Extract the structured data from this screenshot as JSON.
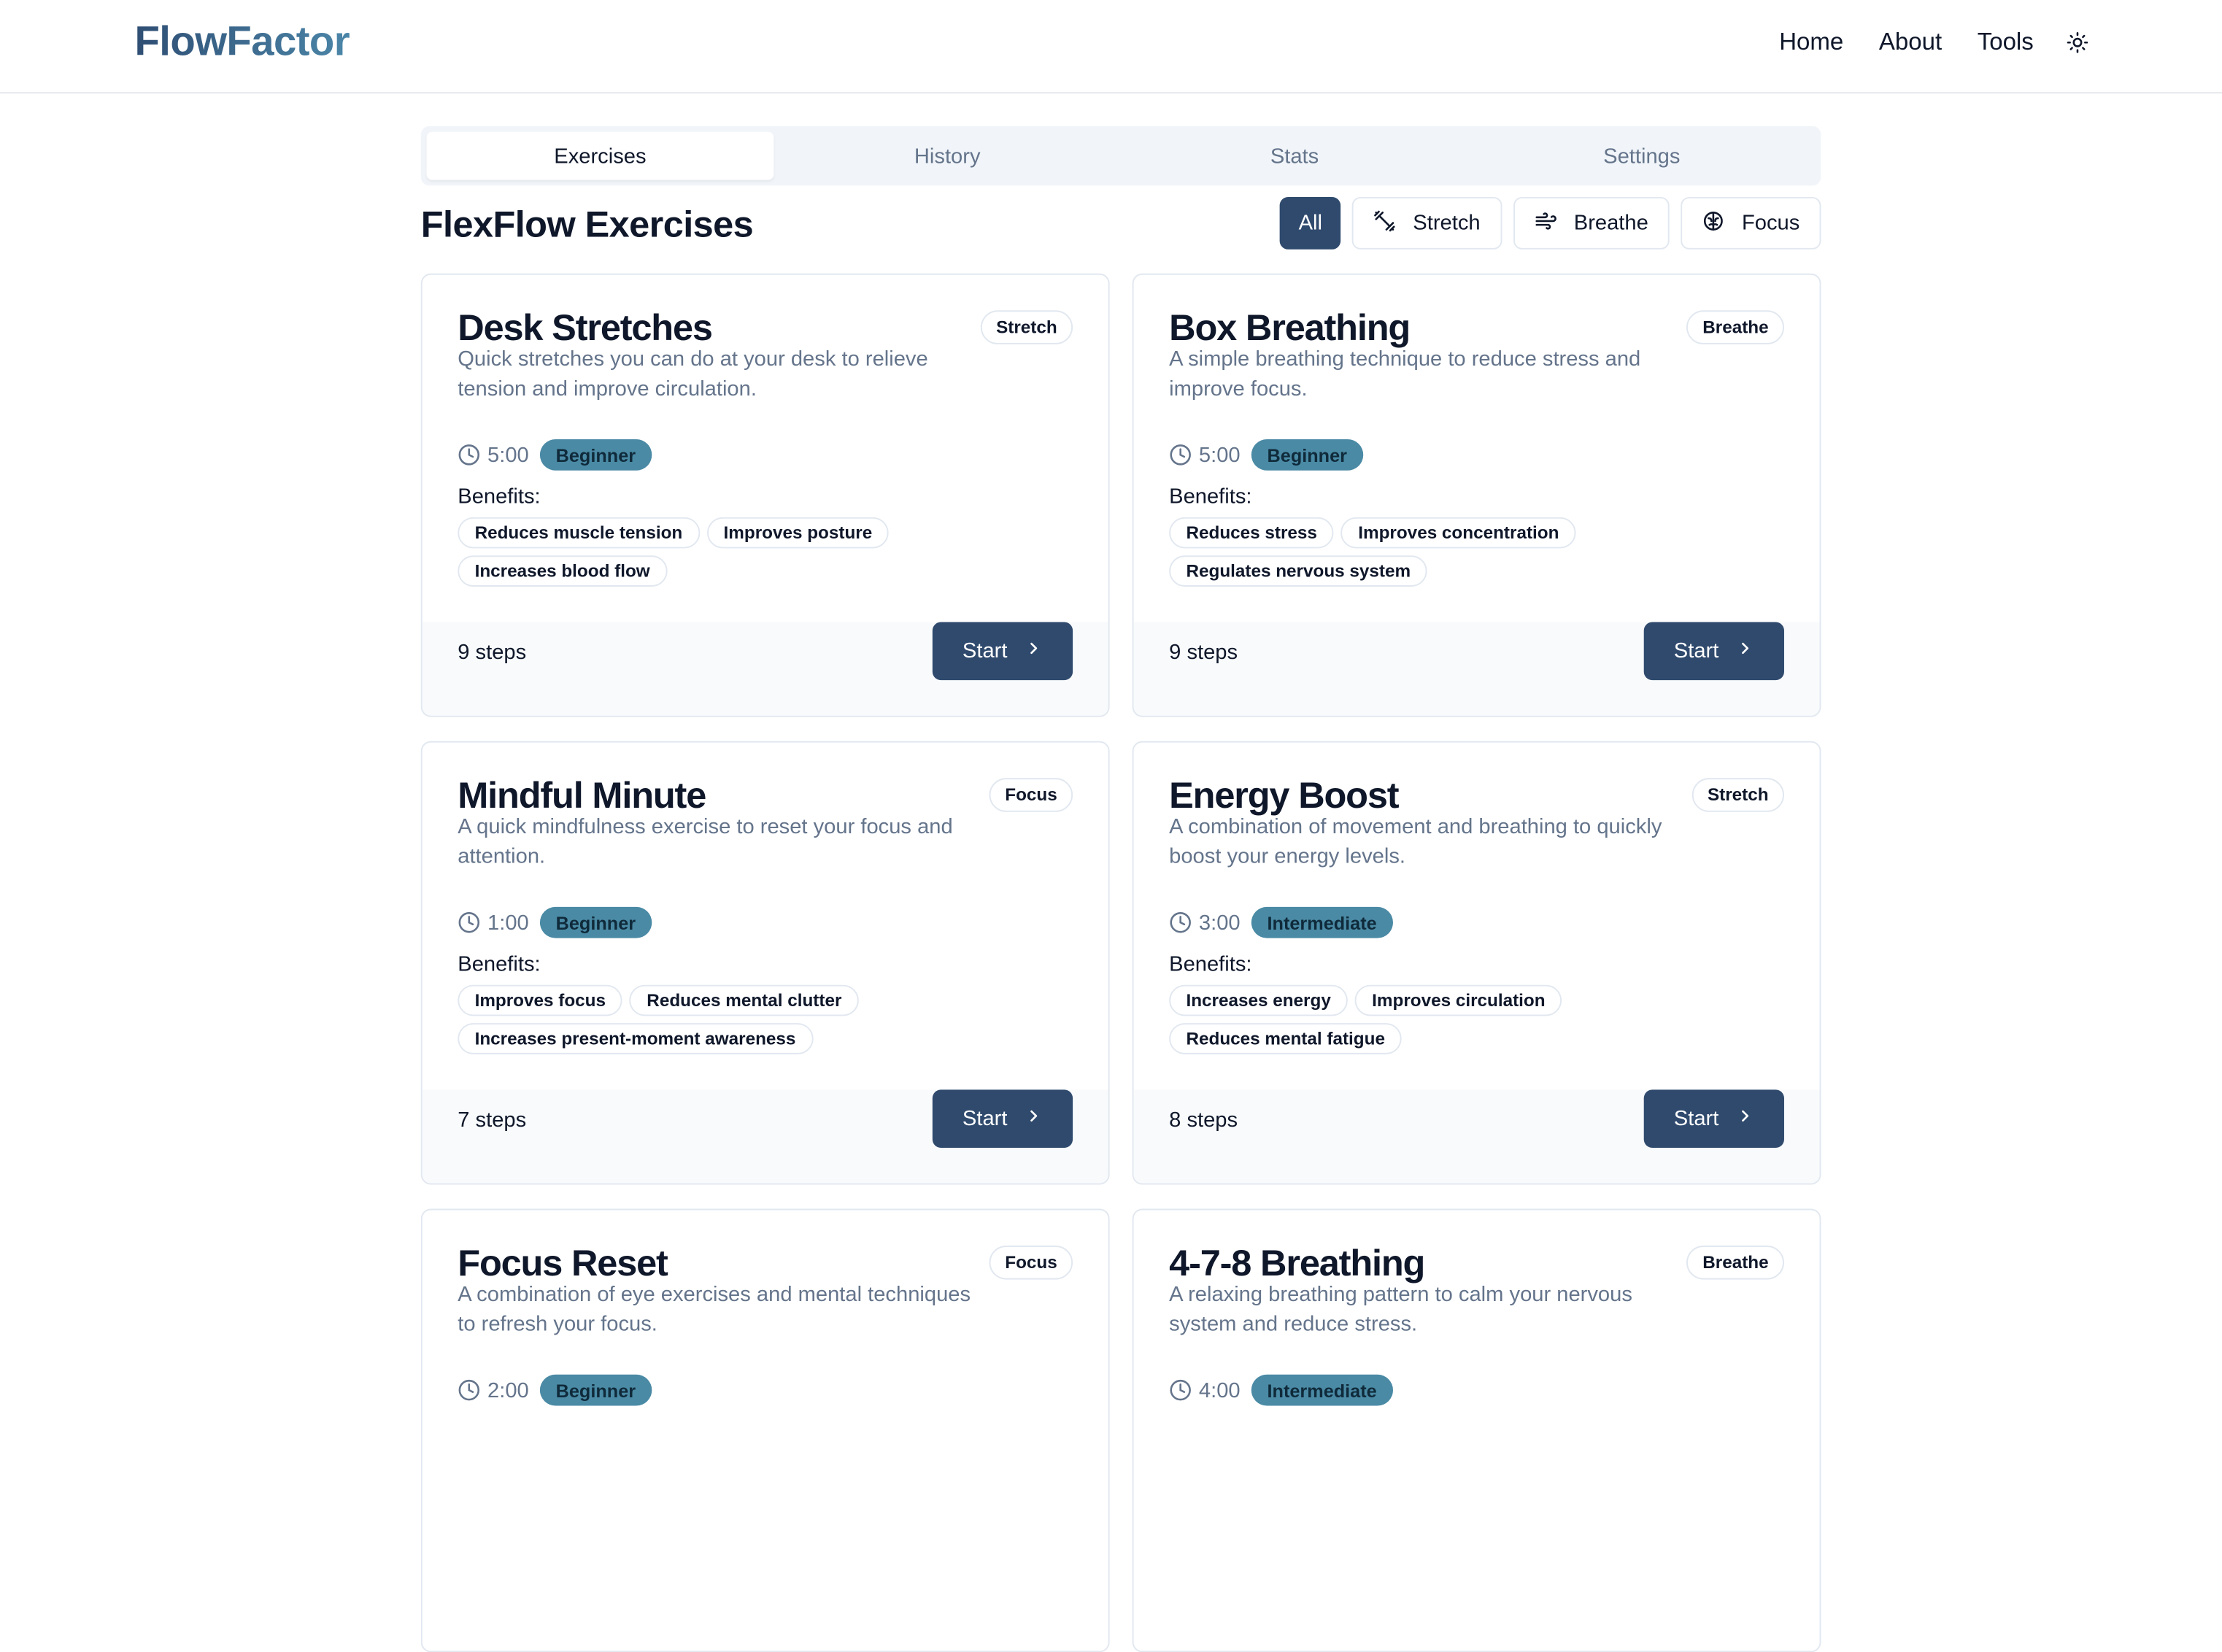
{
  "app": {
    "logo": "FlowFactor"
  },
  "nav": {
    "home": "Home",
    "about": "About",
    "tools": "Tools",
    "theme_icon": "sun-icon"
  },
  "tabs": [
    {
      "label": "Exercises",
      "active": true
    },
    {
      "label": "History",
      "active": false
    },
    {
      "label": "Stats",
      "active": false
    },
    {
      "label": "Settings",
      "active": false
    }
  ],
  "section": {
    "title": "FlexFlow Exercises"
  },
  "filters": {
    "all": "All",
    "stretch": "Stretch",
    "breathe": "Breathe",
    "focus": "Focus"
  },
  "labels": {
    "benefits": "Benefits:",
    "start": "Start"
  },
  "colors": {
    "primary": "#2f4a6d",
    "level_badge": "#4a8aa5",
    "muted_text": "#64748b"
  },
  "exercises": [
    {
      "title": "Desk Stretches",
      "category": "Stretch",
      "description": "Quick stretches you can do at your desk to relieve tension and improve circulation.",
      "duration": "5:00",
      "level": "Beginner",
      "benefits": [
        "Reduces muscle tension",
        "Improves posture",
        "Increases blood flow"
      ],
      "steps": "9 steps"
    },
    {
      "title": "Box Breathing",
      "category": "Breathe",
      "description": "A simple breathing technique to reduce stress and improve focus.",
      "duration": "5:00",
      "level": "Beginner",
      "benefits": [
        "Reduces stress",
        "Improves concentration",
        "Regulates nervous system"
      ],
      "steps": "9 steps"
    },
    {
      "title": "Mindful Minute",
      "category": "Focus",
      "description": "A quick mindfulness exercise to reset your focus and attention.",
      "duration": "1:00",
      "level": "Beginner",
      "benefits": [
        "Improves focus",
        "Reduces mental clutter",
        "Increases present-moment awareness"
      ],
      "steps": "7 steps"
    },
    {
      "title": "Energy Boost",
      "category": "Stretch",
      "description": "A combination of movement and breathing to quickly boost your energy levels.",
      "duration": "3:00",
      "level": "Intermediate",
      "benefits": [
        "Increases energy",
        "Improves circulation",
        "Reduces mental fatigue"
      ],
      "steps": "8 steps"
    },
    {
      "title": "Focus Reset",
      "category": "Focus",
      "description": "A combination of eye exercises and mental techniques to refresh your focus.",
      "duration": "2:00",
      "level": "Beginner",
      "benefits": [],
      "steps": ""
    },
    {
      "title": "4-7-8 Breathing",
      "category": "Breathe",
      "description": "A relaxing breathing pattern to calm your nervous system and reduce stress.",
      "duration": "4:00",
      "level": "Intermediate",
      "benefits": [],
      "steps": ""
    }
  ]
}
